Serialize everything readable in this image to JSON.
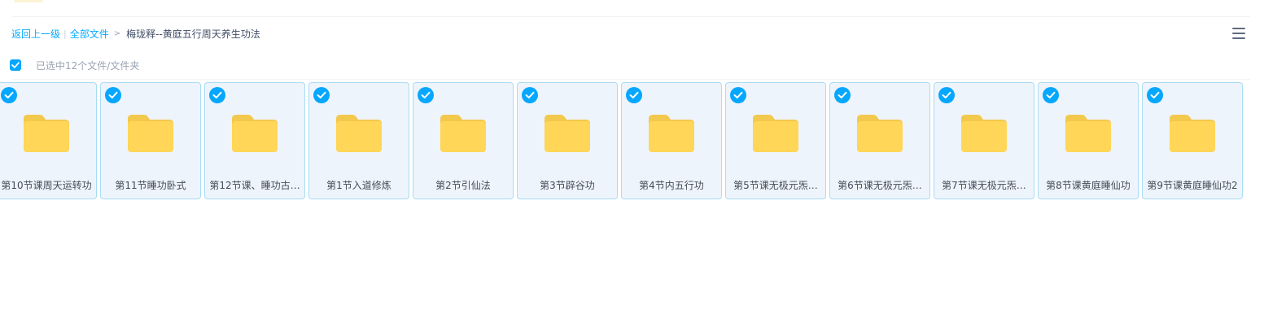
{
  "breadcrumb": {
    "back_label": "返回上一级",
    "separator": "|",
    "root_label": "全部文件",
    "arrow": ">",
    "current_label": "梅珑释--黄庭五行周天养生功法"
  },
  "selection": {
    "summary_text": "已选中12个文件/文件夹",
    "all_selected": true
  },
  "view": {
    "menu_icon": "list-menu-icon"
  },
  "colors": {
    "accent": "#06a7ff",
    "link": "#09aaff",
    "folder": "#ffd658",
    "card_background": "#eef4fb",
    "card_border": "#a9dcf5"
  },
  "files": [
    {
      "name": "第10节课周天运转功",
      "type": "folder",
      "selected": true
    },
    {
      "name": "第11节睡功卧式",
      "type": "folder",
      "selected": true
    },
    {
      "name": "第12节课、睡功古…",
      "type": "folder",
      "selected": true
    },
    {
      "name": "第1节入道修炼",
      "type": "folder",
      "selected": true
    },
    {
      "name": "第2节引仙法",
      "type": "folder",
      "selected": true
    },
    {
      "name": "第3节辟谷功",
      "type": "folder",
      "selected": true
    },
    {
      "name": "第4节内五行功",
      "type": "folder",
      "selected": true
    },
    {
      "name": "第5节课无极元炁…",
      "type": "folder",
      "selected": true
    },
    {
      "name": "第6节课无极元炁…",
      "type": "folder",
      "selected": true
    },
    {
      "name": "第7节课无极元炁…",
      "type": "folder",
      "selected": true
    },
    {
      "name": "第8节课黄庭睡仙功",
      "type": "folder",
      "selected": true
    },
    {
      "name": "第9节课黄庭睡仙功2",
      "type": "folder",
      "selected": true
    }
  ]
}
